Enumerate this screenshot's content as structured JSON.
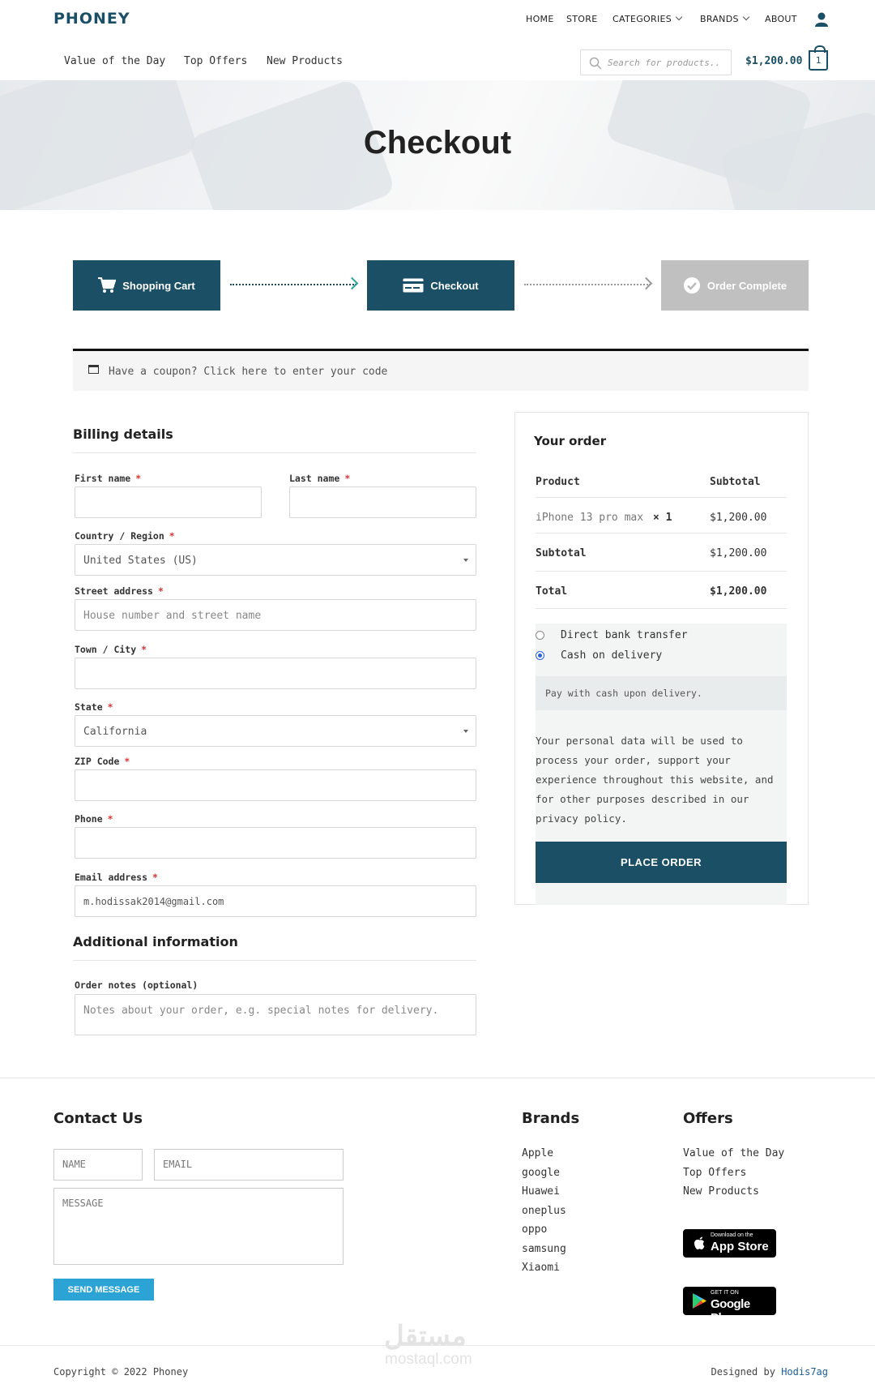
{
  "header": {
    "logo": "PHONEY",
    "nav": [
      "HOME",
      "STORE",
      "CATEGORIES",
      "BRANDS",
      "ABOUT"
    ],
    "subnav": [
      "Value of the Day",
      "Top Offers",
      "New Products"
    ],
    "search_placeholder": "Search for products..",
    "cart_total": "$1,200.00",
    "cart_count": "1"
  },
  "hero": {
    "title": "Checkout"
  },
  "steps": [
    {
      "label": "Shopping Cart",
      "state": "active",
      "icon": "cart-icon"
    },
    {
      "label": "Checkout",
      "state": "active",
      "icon": "card-icon"
    },
    {
      "label": "Order Complete",
      "state": "inactive",
      "icon": "check-circle-icon"
    }
  ],
  "coupon": {
    "text": "Have a coupon? Click here to enter your code"
  },
  "billing": {
    "title": "Billing details",
    "first_name": "First name",
    "last_name": "Last name",
    "country_label": "Country / Region",
    "country_value": "United States (US)",
    "street_label": "Street address",
    "street_placeholder": "House number and street name",
    "city_label": "Town / City",
    "state_label": "State",
    "state_value": "California",
    "zip_label": "ZIP Code",
    "phone_label": "Phone",
    "email_label": "Email address",
    "email_value": "m.hodissak2014@gmail.com",
    "required_mark": "*"
  },
  "additional": {
    "title": "Additional information",
    "notes_label": "Order notes (optional)",
    "notes_placeholder": "Notes about your order, e.g. special notes for delivery."
  },
  "order": {
    "title": "Your order",
    "col_product": "Product",
    "col_subtotal": "Subtotal",
    "item_name": "iPhone 13 pro max",
    "item_qty": "× 1",
    "item_price": "$1,200.00",
    "subtotal_label": "Subtotal",
    "subtotal_value": "$1,200.00",
    "total_label": "Total",
    "total_value": "$1,200.00",
    "payment_bank": "Direct bank transfer",
    "payment_cod": "Cash on delivery",
    "payment_selected": "Cash on delivery",
    "cod_description": "Pay with cash upon delivery.",
    "privacy_lines": [
      "Your personal data will be used to",
      "process your order, support your",
      "experience throughout this website, and",
      "for other purposes described in our",
      "privacy policy."
    ],
    "place_order": "PLACE ORDER"
  },
  "footer": {
    "contact_title": "Contact Us",
    "name_placeholder": "NAME",
    "email_placeholder": "EMAIL",
    "message_placeholder": "MESSAGE",
    "send_label": "SEND MESSAGE",
    "brands_title": "Brands",
    "brands": [
      "Apple",
      "google",
      "Huawei",
      "oneplus",
      "oppo",
      "samsung",
      "Xiaomi"
    ],
    "offers_title": "Offers",
    "offers": [
      "Value of the Day",
      "Top Offers",
      "New Products"
    ],
    "appstore_small": "Download on the",
    "appstore_big": "App Store",
    "googleplay_small": "GET IT ON",
    "googleplay_big": "Google Play",
    "copyright": "Copyright © 2022 Phoney",
    "designed_by": "Designed by",
    "designer": "Hodis7ag"
  },
  "watermark": {
    "text": "مستقل",
    "sub": "mostaql.com"
  },
  "colors": {
    "primary": "#1a4f66",
    "accent_teal": "#2aa198",
    "send_button": "#2ba3d4",
    "required": "#dd3333"
  }
}
